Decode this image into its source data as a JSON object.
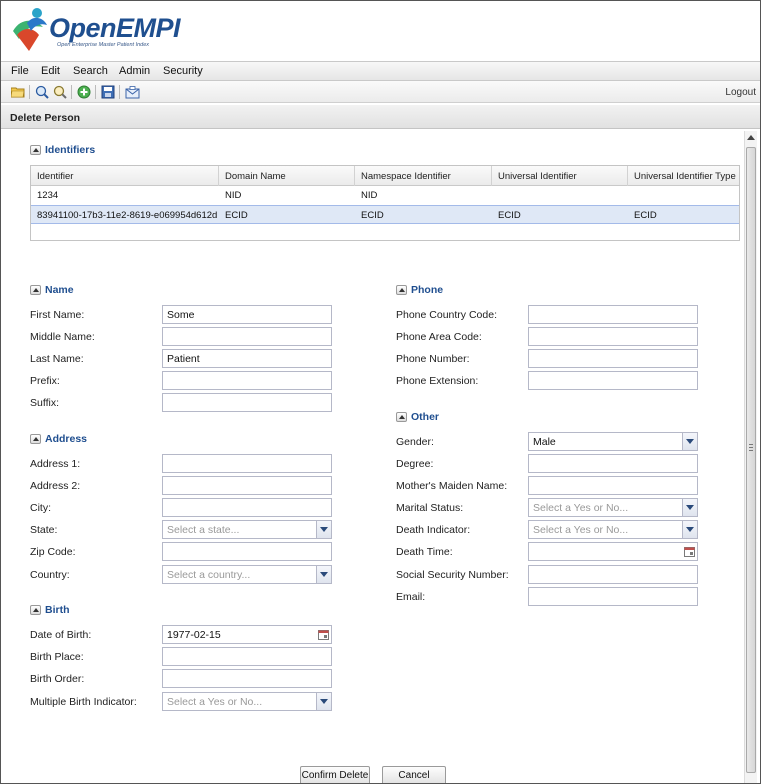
{
  "app": {
    "logo_text": "OpenEMPI",
    "logo_tagline": "Open Enterprise Master Patient Index"
  },
  "menu": [
    "File",
    "Edit",
    "Search",
    "Admin",
    "Security"
  ],
  "toolbar": {
    "logout_label": "Logout",
    "icons": [
      "folder-icon",
      "zoom-in-icon",
      "zoom-out-icon",
      "add-icon",
      "save-icon",
      "mail-icon"
    ]
  },
  "panel": {
    "title": "Delete Person"
  },
  "identifiers": {
    "section_title": "Identifiers",
    "columns": [
      "Identifier",
      "Domain Name",
      "Namespace Identifier",
      "Universal Identifier",
      "Universal Identifier Type"
    ],
    "rows": [
      [
        "1234",
        "NID",
        "NID",
        "",
        ""
      ],
      [
        "83941100-17b3-11e2-8619-e069954d612d",
        "ECID",
        "ECID",
        "ECID",
        "ECID"
      ]
    ]
  },
  "name": {
    "section_title": "Name",
    "first_name_label": "First Name:",
    "first_name_value": "Some",
    "middle_name_label": "Middle Name:",
    "middle_name_value": "",
    "last_name_label": "Last Name:",
    "last_name_value": "Patient",
    "prefix_label": "Prefix:",
    "prefix_value": "",
    "suffix_label": "Suffix:",
    "suffix_value": ""
  },
  "address": {
    "section_title": "Address",
    "address1_label": "Address 1:",
    "address2_label": "Address 2:",
    "city_label": "City:",
    "state_label": "State:",
    "state_placeholder": "Select a state...",
    "zip_label": "Zip Code:",
    "country_label": "Country:",
    "country_placeholder": "Select a country..."
  },
  "birth": {
    "section_title": "Birth",
    "dob_label": "Date of Birth:",
    "dob_value": "1977-02-15",
    "birth_place_label": "Birth Place:",
    "birth_order_label": "Birth Order:",
    "multiple_birth_label": "Multiple Birth Indicator:",
    "multiple_birth_placeholder": "Select a Yes or No..."
  },
  "phone": {
    "section_title": "Phone",
    "country_code_label": "Phone Country Code:",
    "area_code_label": "Phone Area Code:",
    "number_label": "Phone Number:",
    "extension_label": "Phone Extension:"
  },
  "other": {
    "section_title": "Other",
    "gender_label": "Gender:",
    "gender_value": "Male",
    "degree_label": "Degree:",
    "maiden_name_label": "Mother's Maiden Name:",
    "marital_label": "Marital Status:",
    "marital_placeholder": "Select a Yes or No...",
    "death_indicator_label": "Death Indicator:",
    "death_indicator_placeholder": "Select a Yes or No...",
    "death_time_label": "Death Time:",
    "ssn_label": "Social Security Number:",
    "email_label": "Email:"
  },
  "actions": {
    "confirm_label": "Confirm Delete",
    "cancel_label": "Cancel"
  },
  "colors": {
    "section_title": "#1f4e8f",
    "selected_row": "#dfe8f6",
    "logo_text": "#1f4f8f"
  }
}
